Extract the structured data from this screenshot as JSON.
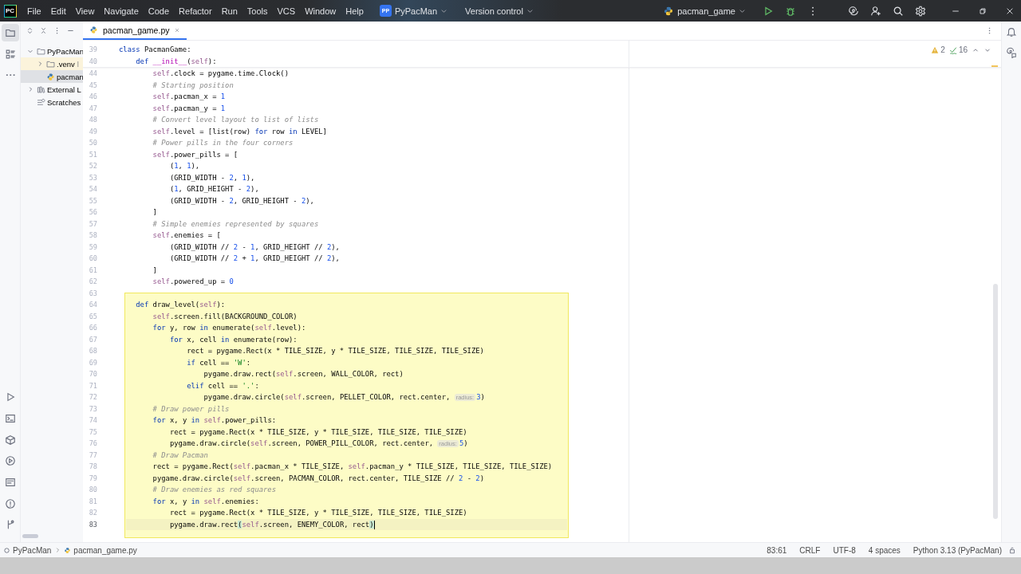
{
  "title_bar": {
    "logo": "PC",
    "menu": [
      "File",
      "Edit",
      "View",
      "Navigate",
      "Code",
      "Refactor",
      "Run",
      "Tools",
      "VCS",
      "Window",
      "Help"
    ],
    "project": {
      "badge": "PP",
      "name": "PyPacMan"
    },
    "vcs": "Version control",
    "run_config": "pacman_game"
  },
  "tool_strip": {
    "top": [
      {
        "kind": "project",
        "selected": true
      },
      {
        "kind": "structure",
        "selected": false
      },
      {
        "kind": "more",
        "selected": false
      }
    ],
    "bottom": [
      {
        "kind": "run",
        "selected": false
      },
      {
        "kind": "console",
        "selected": false
      },
      {
        "kind": "packages",
        "selected": false
      },
      {
        "kind": "services",
        "selected": false
      },
      {
        "kind": "terminal",
        "selected": false
      },
      {
        "kind": "problems",
        "selected": false
      },
      {
        "kind": "git",
        "selected": false
      }
    ]
  },
  "project_panel": {
    "tree": [
      {
        "label": "PyPacMan",
        "kind": "folder",
        "expanded": true,
        "selected": false,
        "children": [
          {
            "label": ".venv",
            "suffix": "l",
            "kind": "excluded",
            "expanded": false,
            "selected": false
          },
          {
            "label": "pacman",
            "kind": "python",
            "selected": true
          }
        ]
      },
      {
        "label": "External L",
        "kind": "library",
        "expanded": false,
        "selected": false
      },
      {
        "label": "Scratches",
        "kind": "scratches",
        "selected": false
      }
    ]
  },
  "editor": {
    "tabs": [
      {
        "label": "pacman_game.py",
        "selected": true
      }
    ],
    "inspections": {
      "warnings": "2",
      "checks": "16"
    },
    "sticky_lines": [
      {
        "number": "39",
        "tokens": [
          {
            "kind": "kw",
            "text": "class"
          },
          {
            "kind": "plain",
            "text": " PacmanGame:"
          }
        ]
      },
      {
        "number": "40",
        "tokens": [
          {
            "kind": "kw",
            "text": "    def"
          },
          {
            "kind": "magic",
            "text": " __init__"
          },
          {
            "kind": "plain",
            "text": "("
          },
          {
            "kind": "self",
            "text": "self"
          },
          {
            "kind": "plain",
            "text": "):"
          }
        ]
      }
    ],
    "lines": [
      {
        "number": "44",
        "current": false,
        "tokens": [
          {
            "kind": "self",
            "text": "        self"
          },
          {
            "kind": "plain",
            "text": ".clock = pygame.time.Clock()"
          }
        ]
      },
      {
        "number": "45",
        "current": false,
        "tokens": [
          {
            "kind": "cmt",
            "text": "        # Starting position"
          }
        ]
      },
      {
        "number": "46",
        "current": false,
        "tokens": [
          {
            "kind": "self",
            "text": "        self"
          },
          {
            "kind": "plain",
            "text": ".pacman_x = "
          },
          {
            "kind": "num",
            "text": "1"
          }
        ]
      },
      {
        "number": "47",
        "current": false,
        "tokens": [
          {
            "kind": "self",
            "text": "        self"
          },
          {
            "kind": "plain",
            "text": ".pacman_y = "
          },
          {
            "kind": "num",
            "text": "1"
          }
        ]
      },
      {
        "number": "48",
        "current": false,
        "tokens": [
          {
            "kind": "cmt",
            "text": "        # Convert level layout to list of lists"
          }
        ]
      },
      {
        "number": "49",
        "current": false,
        "tokens": [
          {
            "kind": "self",
            "text": "        self"
          },
          {
            "kind": "plain",
            "text": ".level = [list(row) "
          },
          {
            "kind": "kw",
            "text": "for"
          },
          {
            "kind": "plain",
            "text": " row "
          },
          {
            "kind": "kw",
            "text": "in"
          },
          {
            "kind": "plain",
            "text": " LEVEL]"
          }
        ]
      },
      {
        "number": "50",
        "current": false,
        "tokens": [
          {
            "kind": "cmt",
            "text": "        # Power pills in the four corners"
          }
        ]
      },
      {
        "number": "51",
        "current": false,
        "tokens": [
          {
            "kind": "self",
            "text": "        self"
          },
          {
            "kind": "plain",
            "text": ".power_pills = ["
          }
        ]
      },
      {
        "number": "52",
        "current": false,
        "tokens": [
          {
            "kind": "plain",
            "text": "            ("
          },
          {
            "kind": "num",
            "text": "1"
          },
          {
            "kind": "plain",
            "text": ", "
          },
          {
            "kind": "num",
            "text": "1"
          },
          {
            "kind": "plain",
            "text": "),"
          }
        ]
      },
      {
        "number": "53",
        "current": false,
        "tokens": [
          {
            "kind": "plain",
            "text": "            (GRID_WIDTH - "
          },
          {
            "kind": "num",
            "text": "2"
          },
          {
            "kind": "plain",
            "text": ", "
          },
          {
            "kind": "num",
            "text": "1"
          },
          {
            "kind": "plain",
            "text": "),"
          }
        ]
      },
      {
        "number": "54",
        "current": false,
        "tokens": [
          {
            "kind": "plain",
            "text": "            ("
          },
          {
            "kind": "num",
            "text": "1"
          },
          {
            "kind": "plain",
            "text": ", GRID_HEIGHT - "
          },
          {
            "kind": "num",
            "text": "2"
          },
          {
            "kind": "plain",
            "text": "),"
          }
        ]
      },
      {
        "number": "55",
        "current": false,
        "tokens": [
          {
            "kind": "plain",
            "text": "            (GRID_WIDTH - "
          },
          {
            "kind": "num",
            "text": "2"
          },
          {
            "kind": "plain",
            "text": ", GRID_HEIGHT - "
          },
          {
            "kind": "num",
            "text": "2"
          },
          {
            "kind": "plain",
            "text": "),"
          }
        ]
      },
      {
        "number": "56",
        "current": false,
        "tokens": [
          {
            "kind": "plain",
            "text": "        ]"
          }
        ]
      },
      {
        "number": "57",
        "current": false,
        "tokens": [
          {
            "kind": "cmt",
            "text": "        # Simple enemies represented by squares"
          }
        ]
      },
      {
        "number": "58",
        "current": false,
        "tokens": [
          {
            "kind": "self",
            "text": "        self"
          },
          {
            "kind": "plain",
            "text": ".enemies = ["
          }
        ]
      },
      {
        "number": "59",
        "current": false,
        "tokens": [
          {
            "kind": "plain",
            "text": "            (GRID_WIDTH // "
          },
          {
            "kind": "num",
            "text": "2"
          },
          {
            "kind": "plain",
            "text": " - "
          },
          {
            "kind": "num",
            "text": "1"
          },
          {
            "kind": "plain",
            "text": ", GRID_HEIGHT // "
          },
          {
            "kind": "num",
            "text": "2"
          },
          {
            "kind": "plain",
            "text": "),"
          }
        ]
      },
      {
        "number": "60",
        "current": false,
        "tokens": [
          {
            "kind": "plain",
            "text": "            (GRID_WIDTH // "
          },
          {
            "kind": "num",
            "text": "2"
          },
          {
            "kind": "plain",
            "text": " + "
          },
          {
            "kind": "num",
            "text": "1"
          },
          {
            "kind": "plain",
            "text": ", GRID_HEIGHT // "
          },
          {
            "kind": "num",
            "text": "2"
          },
          {
            "kind": "plain",
            "text": "),"
          }
        ]
      },
      {
        "number": "61",
        "current": false,
        "tokens": [
          {
            "kind": "plain",
            "text": "        ]"
          }
        ]
      },
      {
        "number": "62",
        "current": false,
        "tokens": [
          {
            "kind": "self",
            "text": "        self"
          },
          {
            "kind": "plain",
            "text": ".powered_up = "
          },
          {
            "kind": "num",
            "text": "0"
          }
        ]
      },
      {
        "number": "63",
        "current": false
      }
    ],
    "highlighted_block": {
      "lines": [
        {
          "number": "64",
          "current": false,
          "tokens": [
            {
              "kind": "kw",
              "text": "    def"
            },
            {
              "kind": "plain",
              "text": " draw_level("
            },
            {
              "kind": "self",
              "text": "self"
            },
            {
              "kind": "plain",
              "text": "):"
            }
          ]
        },
        {
          "number": "65",
          "current": false,
          "tokens": [
            {
              "kind": "self",
              "text": "        self"
            },
            {
              "kind": "plain",
              "text": ".screen.fill(BACKGROUND_COLOR)"
            }
          ]
        },
        {
          "number": "66",
          "current": false,
          "tokens": [
            {
              "kind": "kw",
              "text": "        for"
            },
            {
              "kind": "plain",
              "text": " y, row "
            },
            {
              "kind": "kw",
              "text": "in"
            },
            {
              "kind": "plain",
              "text": " enumerate("
            },
            {
              "kind": "self",
              "text": "self"
            },
            {
              "kind": "plain",
              "text": ".level):"
            }
          ]
        },
        {
          "number": "67",
          "current": false,
          "tokens": [
            {
              "kind": "kw",
              "text": "            for"
            },
            {
              "kind": "plain",
              "text": " x, cell "
            },
            {
              "kind": "kw",
              "text": "in"
            },
            {
              "kind": "plain",
              "text": " enumerate(row):"
            }
          ]
        },
        {
          "number": "68",
          "current": false,
          "tokens": [
            {
              "kind": "plain",
              "text": "                rect = pygame.Rect(x * TILE_SIZE, y * TILE_SIZE, TILE_SIZE, TILE_SIZE)"
            }
          ]
        },
        {
          "number": "69",
          "current": false,
          "tokens": [
            {
              "kind": "kw",
              "text": "                if"
            },
            {
              "kind": "plain",
              "text": " cell == "
            },
            {
              "kind": "str",
              "text": "'W'"
            },
            {
              "kind": "plain",
              "text": ":"
            }
          ]
        },
        {
          "number": "70",
          "current": false,
          "tokens": [
            {
              "kind": "plain",
              "text": "                    pygame.draw.rect("
            },
            {
              "kind": "self",
              "text": "self"
            },
            {
              "kind": "plain",
              "text": ".screen, WALL_COLOR, rect)"
            }
          ]
        },
        {
          "number": "71",
          "current": false,
          "tokens": [
            {
              "kind": "kw",
              "text": "                elif"
            },
            {
              "kind": "plain",
              "text": " cell == "
            },
            {
              "kind": "str",
              "text": "'.'"
            },
            {
              "kind": "plain",
              "text": ":"
            }
          ]
        },
        {
          "number": "72",
          "current": false,
          "tokens": [
            {
              "kind": "plain",
              "text": "                    pygame.draw.circle("
            },
            {
              "kind": "self",
              "text": "self"
            },
            {
              "kind": "plain",
              "text": ".screen, PELLET_COLOR, rect.center, "
            },
            {
              "kind": "hint",
              "text": "radius:"
            },
            {
              "kind": "num",
              "text": "3"
            },
            {
              "kind": "plain",
              "text": ")"
            }
          ]
        },
        {
          "number": "73",
          "current": false,
          "tokens": [
            {
              "kind": "cmt",
              "text": "        # Draw power pills"
            }
          ]
        },
        {
          "number": "74",
          "current": false,
          "tokens": [
            {
              "kind": "kw",
              "text": "        for"
            },
            {
              "kind": "plain",
              "text": " x, y "
            },
            {
              "kind": "kw",
              "text": "in"
            },
            {
              "kind": "self",
              "text": " self"
            },
            {
              "kind": "plain",
              "text": ".power_pills:"
            }
          ]
        },
        {
          "number": "75",
          "current": false,
          "tokens": [
            {
              "kind": "plain",
              "text": "            rect = pygame.Rect(x * TILE_SIZE, y * TILE_SIZE, TILE_SIZE, TILE_SIZE)"
            }
          ]
        },
        {
          "number": "76",
          "current": false,
          "tokens": [
            {
              "kind": "plain",
              "text": "            pygame.draw.circle("
            },
            {
              "kind": "self",
              "text": "self"
            },
            {
              "kind": "plain",
              "text": ".screen, POWER_PILL_COLOR, rect.center, "
            },
            {
              "kind": "hint",
              "text": "radius:"
            },
            {
              "kind": "num",
              "text": "5"
            },
            {
              "kind": "plain",
              "text": ")"
            }
          ]
        },
        {
          "number": "77",
          "current": false,
          "tokens": [
            {
              "kind": "cmt",
              "text": "        # Draw Pacman"
            }
          ]
        },
        {
          "number": "78",
          "current": false,
          "tokens": [
            {
              "kind": "plain",
              "text": "        rect = pygame.Rect("
            },
            {
              "kind": "self",
              "text": "self"
            },
            {
              "kind": "plain",
              "text": ".pacman_x * TILE_SIZE, "
            },
            {
              "kind": "self",
              "text": "self"
            },
            {
              "kind": "plain",
              "text": ".pacman_y * TILE_SIZE, TILE_SIZE, TILE_SIZE)"
            }
          ]
        },
        {
          "number": "79",
          "current": false,
          "tokens": [
            {
              "kind": "plain",
              "text": "        pygame.draw.circle("
            },
            {
              "kind": "self",
              "text": "self"
            },
            {
              "kind": "plain",
              "text": ".screen, PACMAN_COLOR, rect.center, TILE_SIZE // "
            },
            {
              "kind": "num",
              "text": "2"
            },
            {
              "kind": "plain",
              "text": " - "
            },
            {
              "kind": "num",
              "text": "2"
            },
            {
              "kind": "plain",
              "text": ")"
            }
          ]
        },
        {
          "number": "80",
          "current": false,
          "tokens": [
            {
              "kind": "cmt",
              "text": "        # Draw enemies as red squares"
            }
          ]
        },
        {
          "number": "81",
          "current": false,
          "tokens": [
            {
              "kind": "kw",
              "text": "        for"
            },
            {
              "kind": "plain",
              "text": " x, y "
            },
            {
              "kind": "kw",
              "text": "in"
            },
            {
              "kind": "self",
              "text": " self"
            },
            {
              "kind": "plain",
              "text": ".enemies:"
            }
          ]
        },
        {
          "number": "82",
          "current": false,
          "tokens": [
            {
              "kind": "plain",
              "text": "            rect = pygame.Rect(x * TILE_SIZE, y * TILE_SIZE, TILE_SIZE, TILE_SIZE)"
            }
          ]
        },
        {
          "number": "83",
          "current": true,
          "tokens": [
            {
              "kind": "plain",
              "text": "            pygame.draw.rect"
            },
            {
              "kind": "brace",
              "text": "("
            },
            {
              "kind": "self",
              "text": "self"
            },
            {
              "kind": "plain",
              "text": ".screen, ENEMY_COLOR, rect"
            },
            {
              "kind": "brace",
              "text": ")"
            }
          ]
        }
      ]
    }
  },
  "status_bar": {
    "breadcrumbs": [
      "PyPacMan",
      "pacman_game.py"
    ],
    "position": "83:61",
    "line_separator": "CRLF",
    "encoding": "UTF-8",
    "indent": "4 spaces",
    "interpreter": "Python 3.13 (PyPacMan)"
  }
}
